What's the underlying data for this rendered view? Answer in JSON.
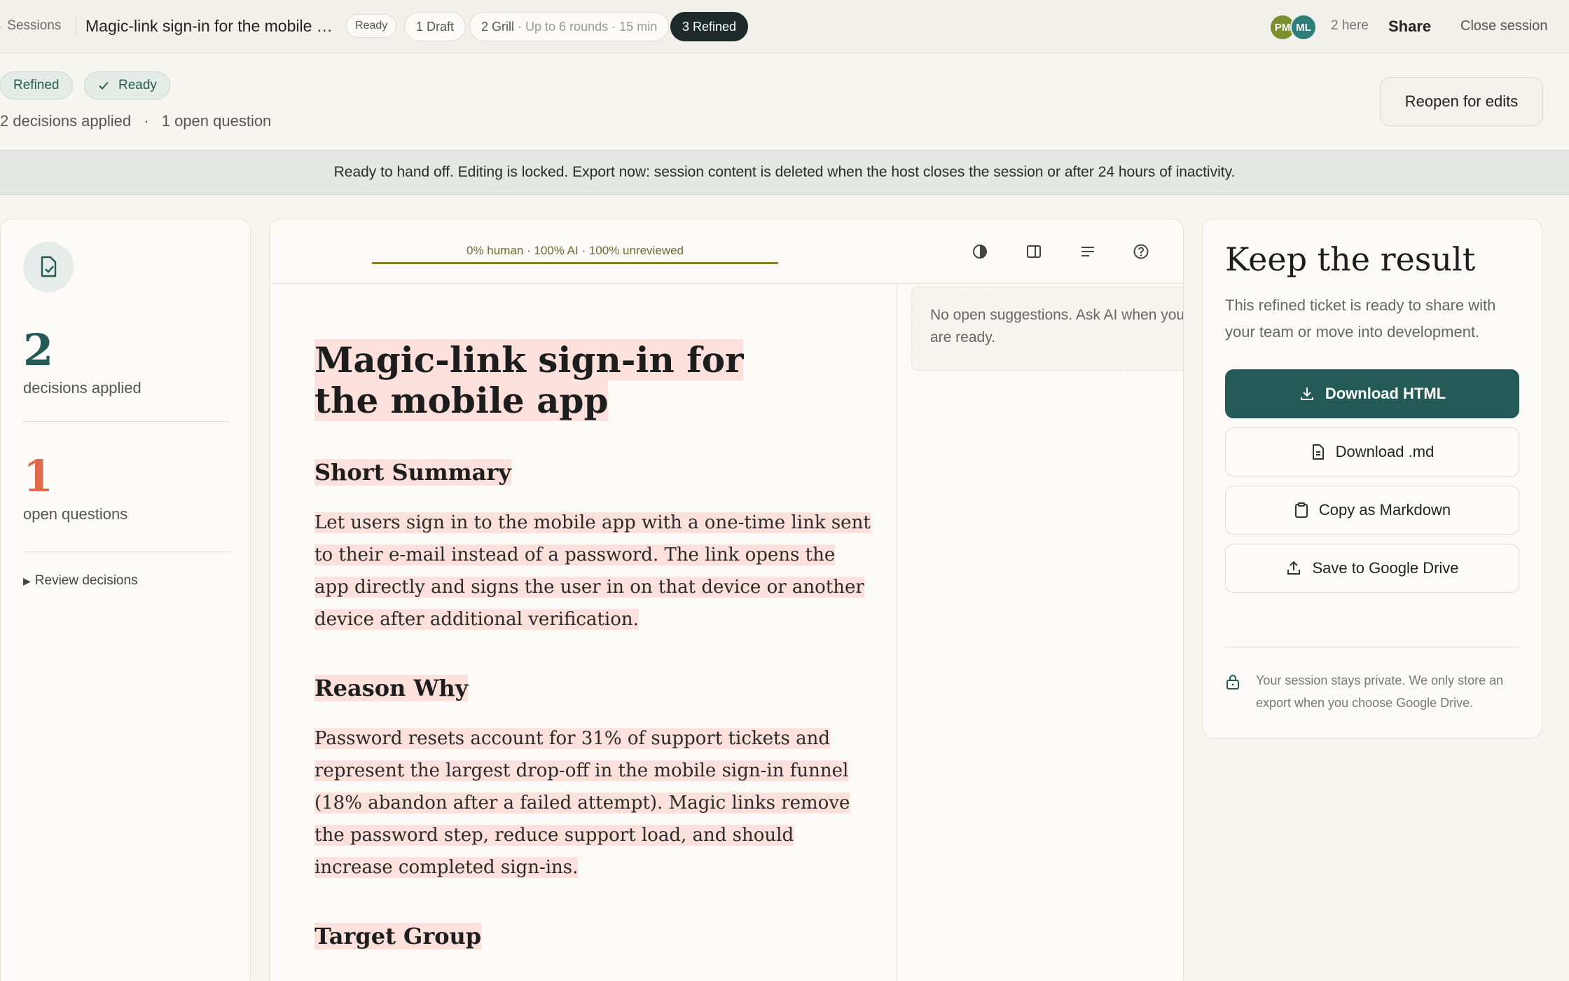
{
  "topbar": {
    "back_label": "← Sessions",
    "title": "Magic-link sign-in for the mobile a...",
    "status_pill": "Ready",
    "steps": [
      {
        "label": "1 Draft",
        "detail": ""
      },
      {
        "label": "2 Grill",
        "detail": "· Up to 6 rounds · 15 min"
      },
      {
        "label": "3 Refined",
        "detail": ""
      }
    ],
    "avatars": [
      "PM",
      "ML"
    ],
    "presence": "2 here",
    "share_label": "Share",
    "close_label": "Close session"
  },
  "status": {
    "badge_refined": "Refined",
    "badge_ready": "Ready",
    "decisions": "2 decisions applied",
    "separator": "·",
    "open_questions": "1 open question",
    "reopen_label": "Reopen for edits"
  },
  "banner": "Ready to hand off. Editing is locked. Export now: session content is deleted when the host closes the session or after 24 hours of inactivity.",
  "left": {
    "decisions_count": "2",
    "decisions_label": "decisions applied",
    "questions_count": "1",
    "questions_label": "open questions",
    "review_label": "Review decisions"
  },
  "editor": {
    "authorship": "0% human · 100% AI · 100% unreviewed",
    "authorship_progress": 1.0,
    "title": "Magic-link sign-in for the mobile app",
    "sections": [
      {
        "heading": "Short Summary",
        "body": "Let users sign in to the mobile app with a one-time link sent to their e-mail instead of a password. The link opens the app directly and signs the user in on that device or another device after additional verification."
      },
      {
        "heading": "Reason Why",
        "body": "Password resets account for 31% of support tickets and represent the largest drop-off in the mobile sign-in funnel (18% abandon after a failed attempt). Magic links remove the password step, reduce support load, and should increase completed sign-ins."
      },
      {
        "heading": "Target Group",
        "body": ""
      }
    ],
    "suggestions_empty": "No open suggestions. Ask AI when you are ready."
  },
  "export": {
    "title": "Keep the result",
    "subtitle": "This refined ticket is ready to share with your team or move into development.",
    "buttons": {
      "download_html": "Download HTML",
      "download_md": "Download .md",
      "copy_md": "Copy as Markdown",
      "google_drive": "Save to Google Drive"
    },
    "privacy": "Your session stays private. We only store an export when you choose Google Drive."
  },
  "colors": {
    "accent": "#235a55",
    "highlight": "#fbe0dc",
    "alert": "#e06a4e"
  }
}
